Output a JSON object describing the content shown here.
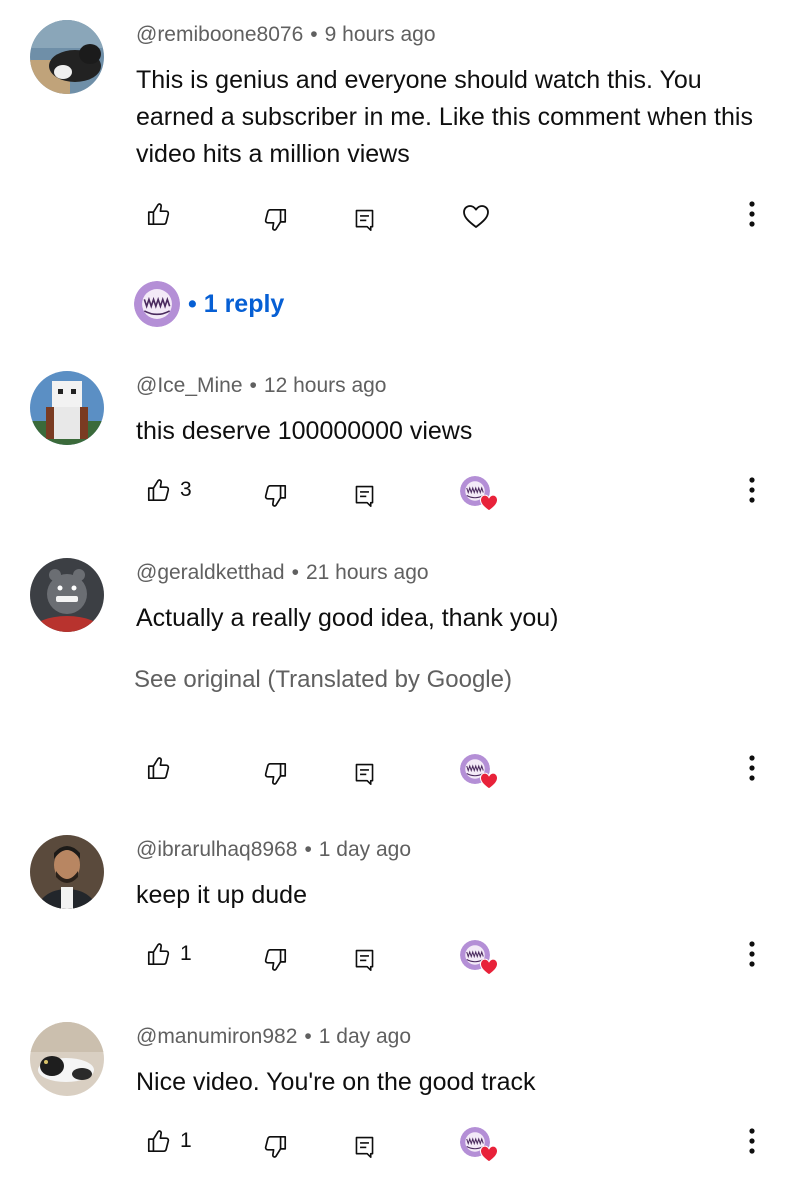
{
  "comments": [
    {
      "author": "@remiboone8076",
      "time": "9 hours ago",
      "text": "This is genius and everyone should watch this. You earned a subscriber in me. Like this comment when this video hits a million views",
      "likes": "",
      "replies_label": "1 reply",
      "replies_dot": "•"
    },
    {
      "author": "@Ice_Mine",
      "time": "12 hours ago",
      "text": "this deserve 100000000 views",
      "likes": "3"
    },
    {
      "author": "@geraldketthad",
      "time": "21 hours ago",
      "text": "Actually a really good idea, thank you)",
      "translation": "See original (Translated by Google)",
      "likes": ""
    },
    {
      "author": "@ibrarulhaq8968",
      "time": "1 day ago",
      "text": "keep it up dude",
      "likes": "1"
    },
    {
      "author": "@manumiron982",
      "time": "1 day ago",
      "text": "Nice video. You're on the good track",
      "likes": "1"
    }
  ],
  "separator": "•",
  "icons": [
    "thumbs-up-icon",
    "thumbs-down-icon",
    "reply-icon",
    "heart-icon",
    "creator-heart-icon",
    "more-vertical-icon"
  ],
  "colors": {
    "link": "#065fd4",
    "meta": "#606060",
    "heart": "#e8223a",
    "creator_avatar": "#b48fd6"
  }
}
